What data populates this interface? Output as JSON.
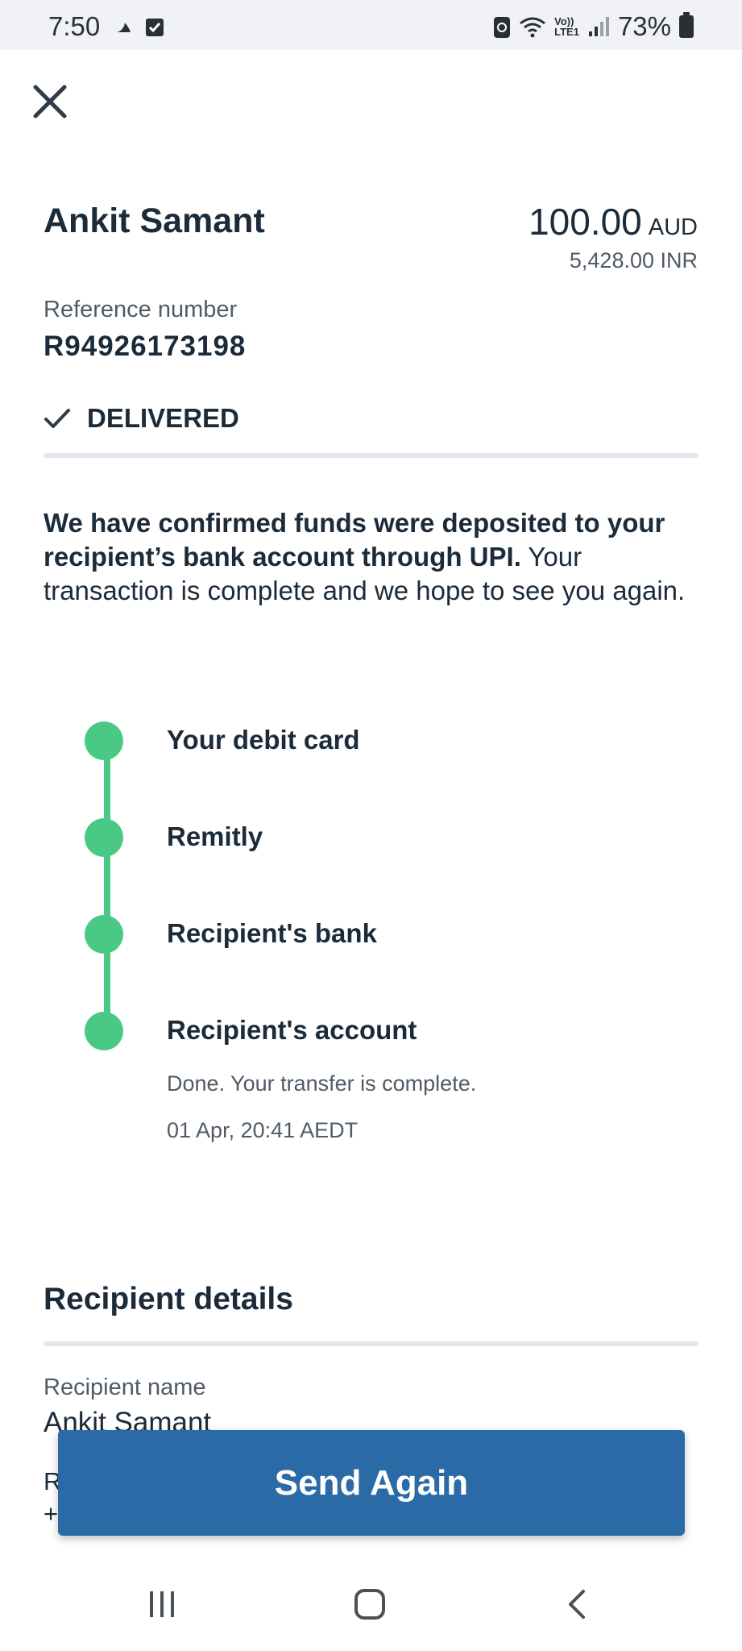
{
  "status_bar": {
    "time": "7:50",
    "battery": "73%",
    "icons": [
      "moon-icon",
      "check-square-icon",
      "sync-icon",
      "wifi-icon",
      "volte-icon",
      "signal-icon",
      "battery-icon"
    ],
    "network_label_top": "Vo))",
    "network_label_bottom": "LTE1"
  },
  "header": {
    "recipient_name": "Ankit Samant",
    "amount": "100.00",
    "amount_currency": "AUD",
    "converted_amount": "5,428.00 INR"
  },
  "reference": {
    "label": "Reference number",
    "value": "R94926173198"
  },
  "status": {
    "label": "DELIVERED"
  },
  "message": {
    "bold": "We have confirmed funds were deposited to your recipient’s bank account through UPI.",
    "regular": " Your transaction is complete and we hope to see you again."
  },
  "timeline": {
    "steps": [
      {
        "label": "Your debit card"
      },
      {
        "label": "Remitly"
      },
      {
        "label": "Recipient's bank"
      },
      {
        "label": "Recipient's account"
      }
    ],
    "final_note": "Done. Your transfer is complete.",
    "final_time": "01 Apr, 20:41 AEDT"
  },
  "recipient_details": {
    "title": "Recipient details",
    "name_label": "Recipient name",
    "name_value": "Ankit Samant",
    "partial_label": "R",
    "partial_value": "+"
  },
  "actions": {
    "send_again": "Send Again"
  },
  "colors": {
    "accent_green": "#4ac985",
    "button_blue": "#2a6aa7",
    "text_dark": "#1c2b3a"
  }
}
